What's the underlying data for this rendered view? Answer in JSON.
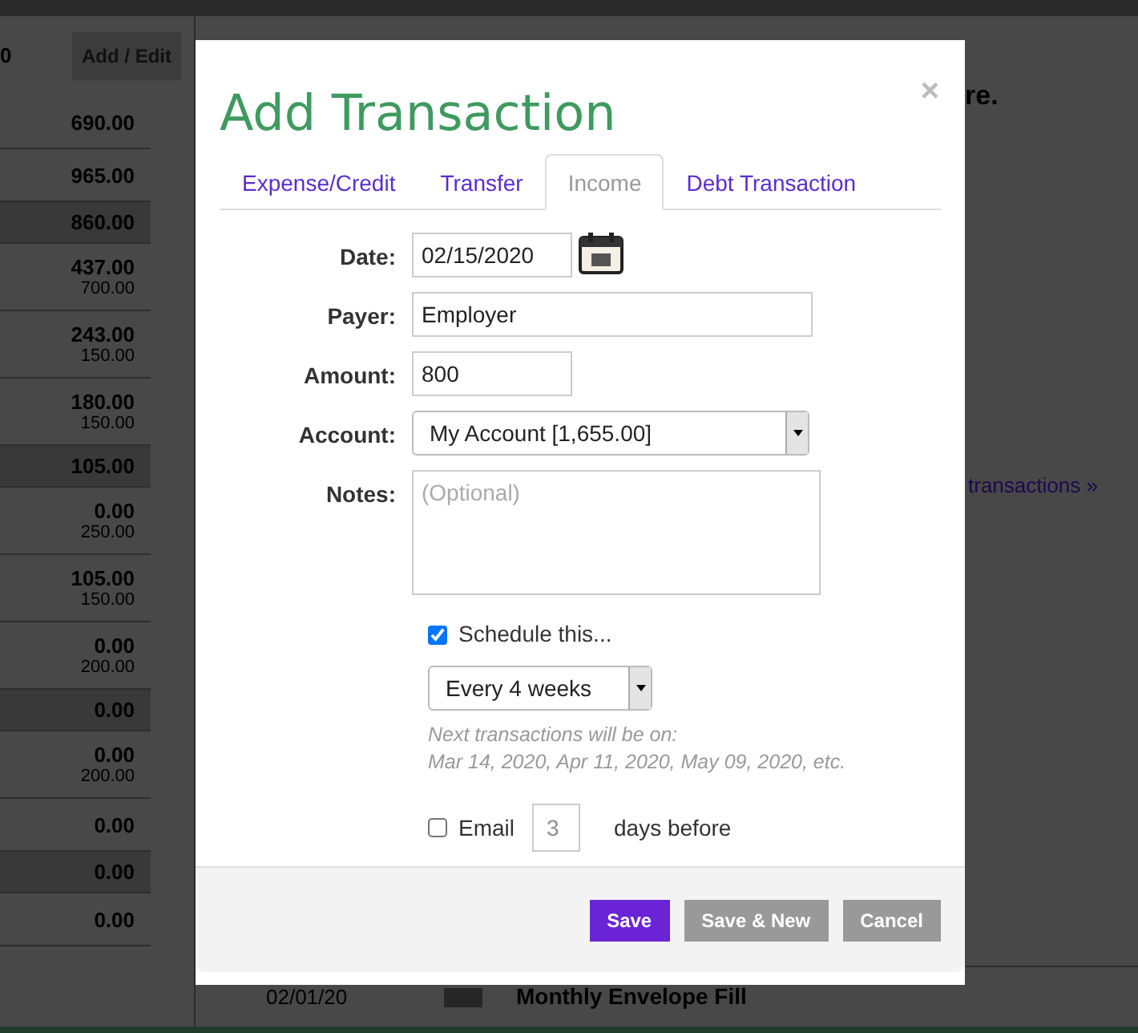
{
  "background": {
    "header_value": "0",
    "add_edit_button": "Add / Edit",
    "amounts": [
      {
        "amount": "690.00",
        "shaded": false
      },
      {
        "amount": "965.00",
        "shaded": false
      },
      {
        "amount": "860.00",
        "shaded": true
      },
      {
        "amount": "437.00",
        "budget": "700.00",
        "shaded": false
      },
      {
        "amount": "243.00",
        "budget": "150.00",
        "shaded": false
      },
      {
        "amount": "180.00",
        "budget": "150.00",
        "shaded": false
      },
      {
        "amount": "105.00",
        "shaded": true
      },
      {
        "amount": "0.00",
        "budget": "250.00",
        "shaded": false
      },
      {
        "amount": "105.00",
        "budget": "150.00",
        "shaded": false
      },
      {
        "amount": "0.00",
        "budget": "200.00",
        "shaded": false
      },
      {
        "amount": "0.00",
        "shaded": true
      },
      {
        "amount": "0.00",
        "budget": "200.00",
        "shaded": false
      },
      {
        "amount": "0.00",
        "shaded": false
      },
      {
        "amount": "0.00",
        "shaded": true
      },
      {
        "amount": "0.00",
        "shaded": false
      }
    ],
    "heading_fragment": "re.",
    "transactions_link": "transactions »",
    "bottom_row": {
      "date": "02/01/20",
      "title": "Monthly Envelope Fill"
    }
  },
  "modal": {
    "title": "Add Transaction",
    "close": "×",
    "tabs": [
      {
        "label": "Expense/Credit",
        "selected": false
      },
      {
        "label": "Transfer",
        "selected": false
      },
      {
        "label": "Income",
        "selected": true
      },
      {
        "label": "Debt Transaction",
        "selected": false
      }
    ],
    "fields": [
      {
        "kind": "date",
        "label": "Date:",
        "value": "02/15/2020"
      },
      {
        "kind": "text",
        "label": "Payer:",
        "value": "Employer"
      },
      {
        "kind": "short",
        "label": "Amount:",
        "value": "800"
      },
      {
        "kind": "select",
        "label": "Account:",
        "value": "My Account [1,655.00]"
      },
      {
        "kind": "textarea",
        "label": "Notes:",
        "placeholder": "(Optional)"
      }
    ],
    "schedule": {
      "label": "Schedule this...",
      "checked": true,
      "frequency": "Every 4 weeks",
      "note": [
        "Next transactions will be on:",
        "Mar 14, 2020, Apr 11, 2020, May 09, 2020, etc."
      ]
    },
    "email": {
      "label": "Email",
      "checked": false,
      "days_placeholder": "3",
      "suffix": "days before"
    },
    "buttons": [
      {
        "label": "Save",
        "kind": "primary"
      },
      {
        "label": "Save & New",
        "kind": "secondary"
      },
      {
        "label": "Cancel",
        "kind": "secondary"
      }
    ]
  }
}
